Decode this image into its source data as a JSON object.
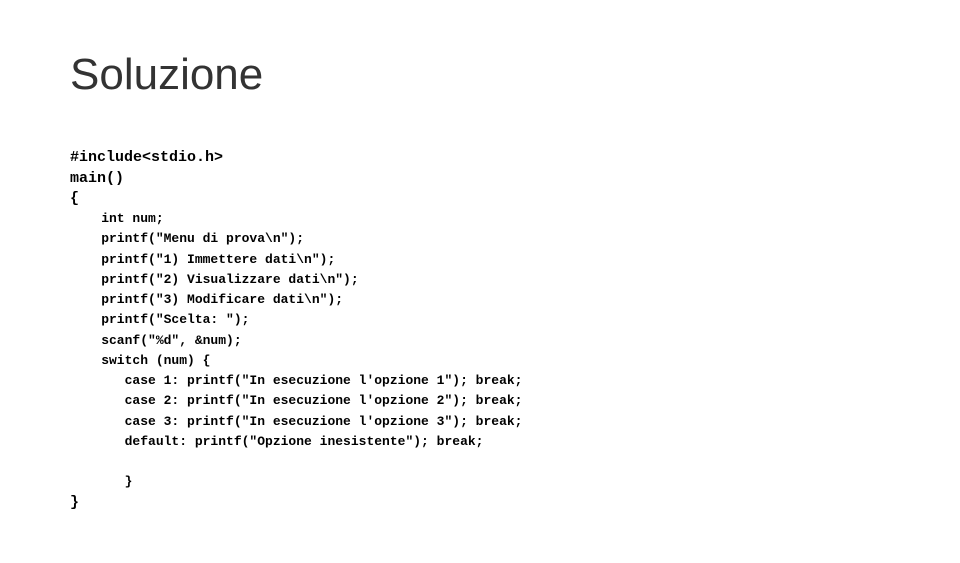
{
  "title": "Soluzione",
  "code": {
    "l1": "#include<stdio.h>",
    "l2": "main()",
    "l3": "{",
    "l4": "    int num;",
    "l5": "    printf(\"Menu di prova\\n\");",
    "l6": "    printf(\"1) Immettere dati\\n\");",
    "l7": "    printf(\"2) Visualizzare dati\\n\");",
    "l8": "    printf(\"3) Modificare dati\\n\");",
    "l9": "    printf(\"Scelta: \");",
    "l10": "    scanf(\"%d\", &num);",
    "l11": "    switch (num) {",
    "l12": "       case 1: printf(\"In esecuzione l'opzione 1\"); break;",
    "l13": "       case 2: printf(\"In esecuzione l'opzione 2\"); break;",
    "l14": "       case 3: printf(\"In esecuzione l'opzione 3\"); break;",
    "l15": "       default: printf(\"Opzione inesistente\"); break;",
    "l16": "       }",
    "l17": "}"
  }
}
